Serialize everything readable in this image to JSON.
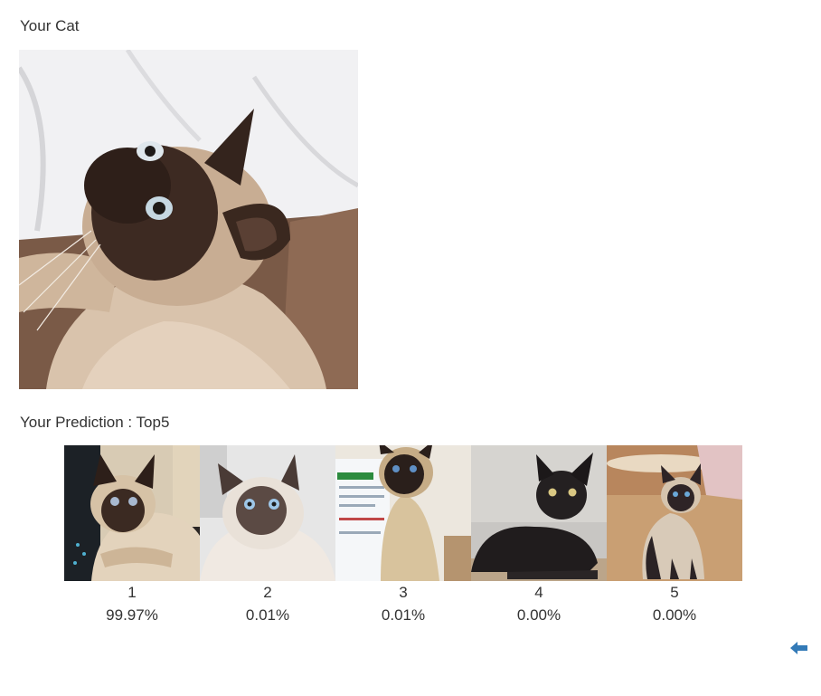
{
  "user_section": {
    "heading": "Your Cat",
    "photo_icon": "siamese-cat-photo"
  },
  "prediction_section": {
    "heading": "Your Prediction : Top5",
    "results": [
      {
        "rank": "1",
        "probability": "99.97%"
      },
      {
        "rank": "2",
        "probability": "0.01%"
      },
      {
        "rank": "3",
        "probability": "0.01%"
      },
      {
        "rank": "4",
        "probability": "0.00%"
      },
      {
        "rank": "5",
        "probability": "0.00%"
      }
    ]
  },
  "navigation": {
    "back_icon": "arrow-left-icon",
    "accent_color": "#337ab7"
  }
}
